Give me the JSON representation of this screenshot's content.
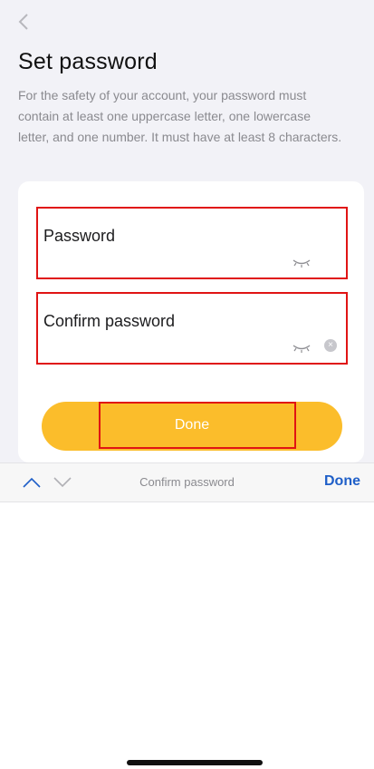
{
  "header": {
    "back_icon": "chevron-left-icon",
    "title": "Set password",
    "description": "For the safety of your account, your password must contain at least one uppercase letter, one lowercase letter, and one number. It must have at least 8 characters."
  },
  "form": {
    "password": {
      "label": "Password",
      "value": "",
      "eye_icon": "eye-closed-icon"
    },
    "confirm_password": {
      "label": "Confirm password",
      "value": "",
      "eye_icon": "eye-closed-icon",
      "clear_icon": "clear-icon"
    },
    "done_button": {
      "label": "Done",
      "color": "#fbbd2b"
    }
  },
  "keyboard_toolbar": {
    "title": "Confirm password",
    "done_label": "Done",
    "prev_icon": "chevron-up-icon",
    "next_icon": "chevron-down-icon",
    "accent": "#1f5fc8"
  },
  "colors": {
    "highlight": "#e01414",
    "background": "#f2f2f7"
  }
}
